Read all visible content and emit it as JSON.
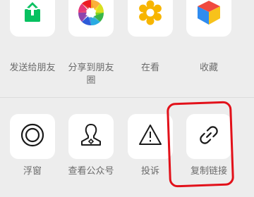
{
  "share_row": [
    {
      "label": "发送给朋友",
      "icon": "share-upload-icon"
    },
    {
      "label": "分享到朋友圈",
      "icon": "moments-aperture-icon"
    },
    {
      "label": "在看",
      "icon": "wow-flower-icon"
    },
    {
      "label": "收藏",
      "icon": "favorites-cube-icon"
    }
  ],
  "action_row": [
    {
      "label": "浮窗",
      "icon": "float-window-icon"
    },
    {
      "label": "查看公众号",
      "icon": "official-account-icon"
    },
    {
      "label": "投诉",
      "icon": "warning-triangle-icon"
    },
    {
      "label": "复制链接",
      "icon": "link-icon"
    }
  ],
  "colors": {
    "background": "#ededed",
    "tile": "#ffffff",
    "label": "#6b6b6b",
    "highlight": "#e2111a",
    "share_green": "#07c160"
  }
}
